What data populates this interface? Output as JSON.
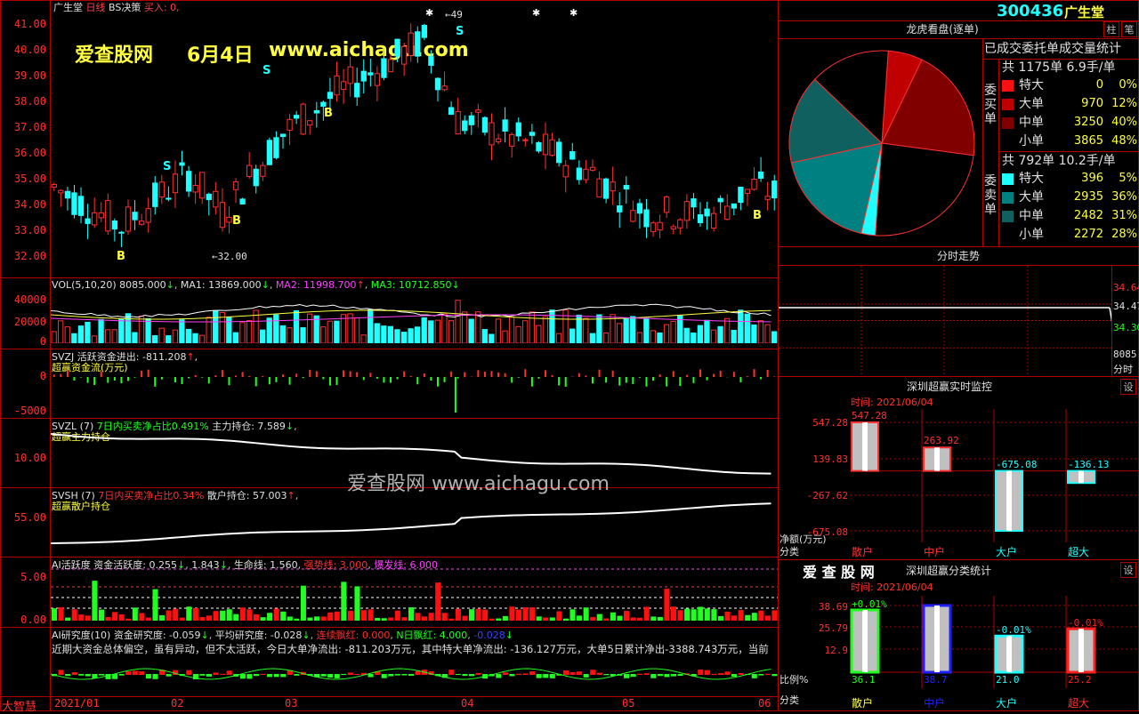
{
  "stock": {
    "name": "广生堂",
    "period": "日线",
    "strategy": "BS决策",
    "signal": "买入: 0,",
    "code": "300436"
  },
  "watermark": {
    "site": "爱查股网",
    "date": "6月4日",
    "url": "www.aichagu.com",
    "mid": "爱查股网   www.aichagu.com"
  },
  "price_axis": [
    "41.00",
    "40.00",
    "39.00",
    "38.00",
    "37.00",
    "36.00",
    "35.00",
    "34.00",
    "33.00",
    "32.00"
  ],
  "price_min_label": "32.00",
  "top_marker": "49",
  "bs_labels": [
    "B",
    "B",
    "B",
    "B",
    "S",
    "S",
    "S"
  ],
  "vol": {
    "header": "VOL(5,10,20) 8085.000",
    "ma1": "MA1: 13869.000",
    "ma2": "MA2: 11998.700",
    "ma3": "MA3: 10712.850",
    "axis": [
      "40000",
      "20000",
      "0"
    ]
  },
  "svzj": {
    "header": "SVZJ  活跃资金进出: -811.208",
    "sub": "超赢资金流(万元)",
    "axis": [
      "0",
      "-5000"
    ]
  },
  "svzl": {
    "header": "SVZL (7)",
    "h2": "7日内买卖净占比0.491%",
    "h3": "主力持仓: 7.589",
    "sub": "超赢主力持仓",
    "axis": [
      "10.00"
    ]
  },
  "svsh": {
    "header": "SVSH (7)",
    "h2": "7日内买卖净占比0.34%",
    "h3": "散户持仓: 57.003",
    "sub": "超赢散户持仓",
    "axis": [
      "55.00"
    ]
  },
  "ai": {
    "header": "AI活跃度  资金活跃度: 0.255",
    "v2": "1.843",
    "v3": "生命线: 1.560",
    "v4": "强势线: 3.000",
    "v5": "爆发线: 6.000",
    "axis": [
      "5.00",
      "0.00"
    ]
  },
  "air": {
    "header": "AI研究度(10) 资金研究度: -0.059",
    "v2": "平均研究度: -0.028",
    "v3": "连续飘红: 0.000",
    "v4": "N日飘红: 4.000",
    "v5": "-0.028",
    "note": "近期大资金总体偏空，虽有异动，但不太活跃，今日大单净流出: -811.203万元，其中特大单净流出: -136.127万元，大单5日累计净出-3388.743万元，当前"
  },
  "dates": {
    "corner": "大智慧",
    "labels": [
      "2021/01",
      "02",
      "03",
      "04",
      "05",
      "06"
    ]
  },
  "right": {
    "dragon_title": "龙虎看盘(逐单)",
    "stat_title": "已成交委托单成交量统计",
    "buy_side": "委买单",
    "sell_side": "委卖单",
    "buy_total": "共 1175单 6.9手/单",
    "sell_total": "共 792单 10.2手/单",
    "buy_rows": [
      {
        "label": "特大",
        "count": "0",
        "pct": "0%",
        "color": "#ff1010"
      },
      {
        "label": "大单",
        "count": "970",
        "pct": "12%",
        "color": "#c00000"
      },
      {
        "label": "中单",
        "count": "3250",
        "pct": "40%",
        "color": "#800000"
      },
      {
        "label": "小单",
        "count": "3865",
        "pct": "48%",
        "color": "#000000"
      }
    ],
    "sell_rows": [
      {
        "label": "特大",
        "count": "396",
        "pct": "5%",
        "color": "#20ffff"
      },
      {
        "label": "大单",
        "count": "2935",
        "pct": "36%",
        "color": "#008080"
      },
      {
        "label": "中单",
        "count": "2482",
        "pct": "31%",
        "color": "#106060"
      },
      {
        "label": "小单",
        "count": "2272",
        "pct": "28%",
        "color": "#000000"
      }
    ],
    "intraday_title": "分时走势",
    "intraday_axis": [
      "34.64",
      "34.47",
      "34.30",
      "8085",
      "分时"
    ],
    "monitor_title": "深圳超赢实时监控",
    "monitor_time": "时间: 2021/06/04",
    "monitor_axis": [
      "547.28",
      "139.83",
      "-267.62",
      "-675.08"
    ],
    "monitor_axis_label": "净额(万元)",
    "monitor_values": [
      "547.28",
      "263.92",
      "-675.08",
      "-136.13"
    ],
    "categories": [
      "散户",
      "中户",
      "大户",
      "超大"
    ],
    "cat_label": "分类",
    "class_brand": "爱 查 股 网",
    "class_title": "深圳超赢分类统计",
    "class_time": "时间: 2021/06/04",
    "class_axis": [
      "38.69",
      "25.79",
      "12.9"
    ],
    "class_axis_label": "比例%",
    "class_top": [
      "+0.01%",
      "",
      "-0.01%",
      "-0.01%"
    ],
    "class_bottom": [
      "36.1",
      "38.7",
      "21.0",
      "25.2"
    ],
    "btn_zhu": "柱",
    "btn_bi": "笔",
    "btn_set": "设"
  },
  "chart_data": [
    {
      "type": "pie",
      "title": "龙虎看盘(逐单)",
      "slices": [
        {
          "label": "委买单 大单",
          "value": 12
        },
        {
          "label": "委买单 中单",
          "value": 40
        },
        {
          "label": "委买单 小单",
          "value": 48
        },
        {
          "label": "委卖单 特大",
          "value": 5
        },
        {
          "label": "委卖单 大单",
          "value": 36
        },
        {
          "label": "委卖单 中单",
          "value": 31
        },
        {
          "label": "委卖单 小单",
          "value": 28
        }
      ]
    },
    {
      "type": "bar",
      "title": "深圳超赢实时监控",
      "categories": [
        "散户",
        "中户",
        "大户",
        "超大"
      ],
      "values": [
        547.28,
        263.92,
        -675.08,
        -136.13
      ],
      "ylabel": "净额(万元)",
      "ylim": [
        -675.08,
        547.28
      ]
    },
    {
      "type": "bar",
      "title": "深圳超赢分类统计",
      "categories": [
        "散户",
        "中户",
        "大户",
        "超大"
      ],
      "values": [
        36.1,
        38.7,
        21.0,
        25.2
      ],
      "ylabel": "比例%",
      "ylim": [
        0,
        38.69
      ]
    }
  ]
}
